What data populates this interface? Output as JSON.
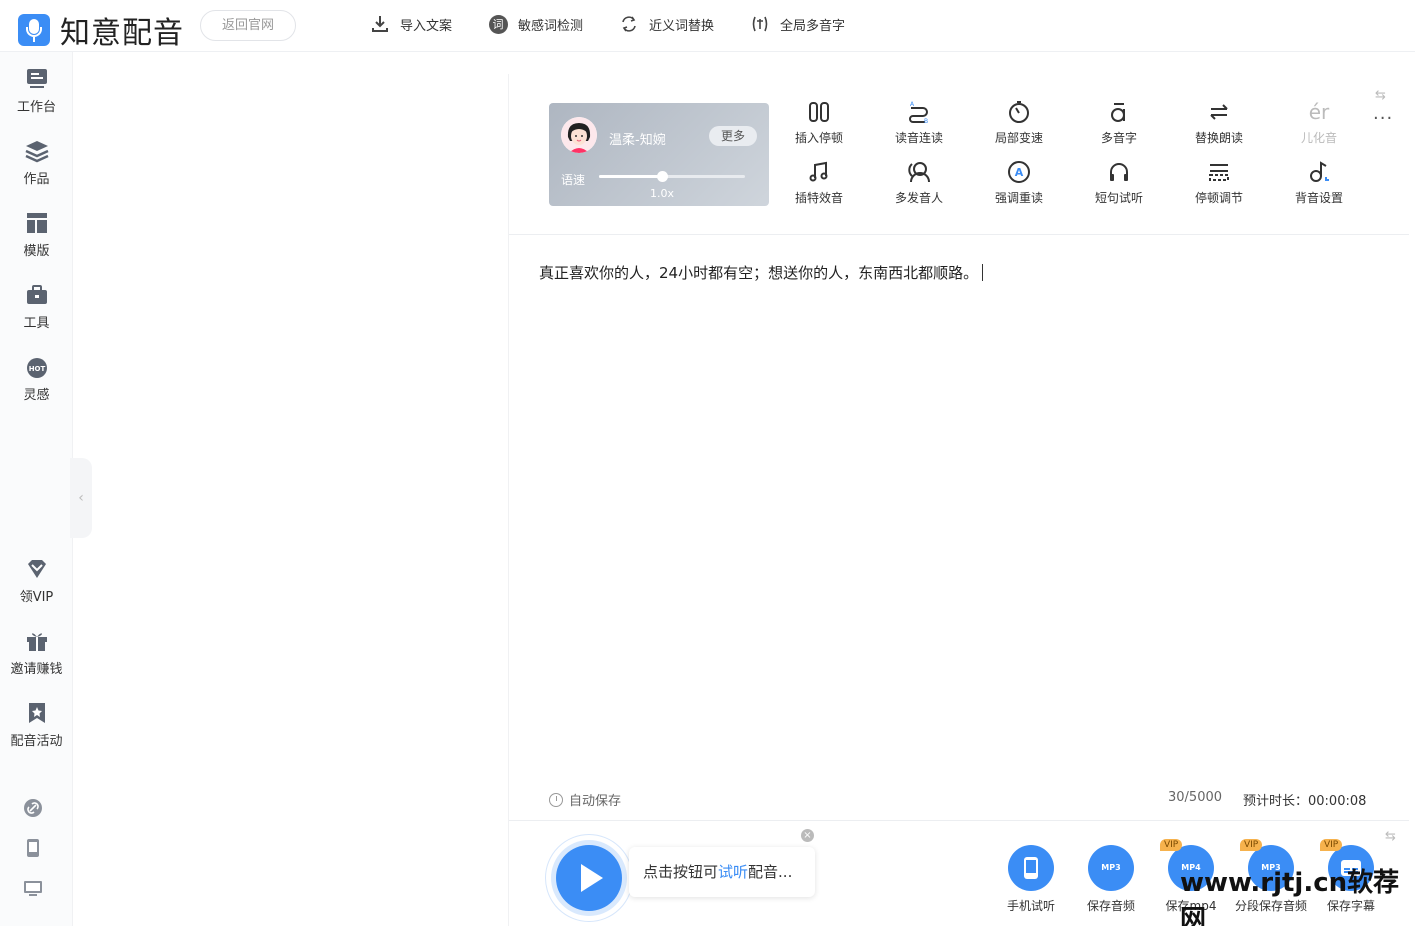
{
  "header": {
    "app_name": "知意配音",
    "back_label": "返回官网",
    "tools": [
      {
        "label": "导入文案",
        "icon": "import-icon"
      },
      {
        "label": "敏感词检测",
        "icon": "sensitive-word-icon",
        "badge": "词"
      },
      {
        "label": "近义词替换",
        "icon": "synonym-replace-icon"
      },
      {
        "label": "全局多音字",
        "icon": "polyphonic-global-icon"
      }
    ]
  },
  "sidebar": {
    "items": [
      {
        "label": "工作台",
        "icon": "workbench-icon"
      },
      {
        "label": "作品",
        "icon": "works-icon"
      },
      {
        "label": "模版",
        "icon": "template-icon"
      },
      {
        "label": "工具",
        "icon": "toolbox-icon"
      },
      {
        "label": "灵感",
        "icon": "inspiration-hot-icon",
        "badge": "HOT"
      }
    ],
    "bottom_items": [
      {
        "label": "领VIP",
        "icon": "vip-diamond-icon"
      },
      {
        "label": "邀请赚钱",
        "icon": "gift-icon"
      },
      {
        "label": "配音活动",
        "icon": "activity-star-icon"
      }
    ],
    "extra_icons": [
      "link-icon",
      "tablet-icon",
      "monitor-icon"
    ]
  },
  "voice": {
    "name": "温柔-知婉",
    "more_label": "更多",
    "speed_label": "语速",
    "speed_value": "1.0x",
    "speed_fraction": 0.43
  },
  "toolbar": {
    "row1": [
      {
        "label": "插入停顿",
        "icon": "insert-pause-icon"
      },
      {
        "label": "读音连读",
        "icon": "liaison-icon"
      },
      {
        "label": "局部变速",
        "icon": "local-speed-icon"
      },
      {
        "label": "多音字",
        "icon": "polyphonic-icon"
      },
      {
        "label": "替换朗读",
        "icon": "replace-read-icon"
      },
      {
        "label": "儿化音",
        "icon": "erhua-icon",
        "glyph": "ér",
        "disabled": true
      }
    ],
    "row2": [
      {
        "label": "插特效音",
        "icon": "sound-effect-icon"
      },
      {
        "label": "多发音人",
        "icon": "multi-speaker-icon"
      },
      {
        "label": "强调重读",
        "icon": "emphasis-icon"
      },
      {
        "label": "短句试听",
        "icon": "headphone-icon"
      },
      {
        "label": "停顿调节",
        "icon": "pause-adjust-icon"
      },
      {
        "label": "背音设置",
        "icon": "bgm-icon"
      }
    ],
    "more": "···"
  },
  "editor": {
    "text": "真正喜欢你的人，24小时都有空；想送你的人，东南西北都顺路。"
  },
  "status": {
    "autosave": "自动保存",
    "wordcount": "30/5000",
    "duration": "预计时长：00:00:08"
  },
  "bottom": {
    "tip_prefix": "点击按钮可",
    "tip_link": "试听",
    "tip_suffix": "配音...",
    "outputs": [
      {
        "label": "手机试听",
        "icon": "phone-preview-icon",
        "vip": false,
        "tag": ""
      },
      {
        "label": "保存音频",
        "icon": "save-mp3-icon",
        "vip": false,
        "tag": "MP3"
      },
      {
        "label": "保存mp4",
        "icon": "save-mp4-icon",
        "vip": true,
        "tag": "MP4"
      },
      {
        "label": "分段保存音频",
        "icon": "segment-save-icon",
        "vip": true,
        "tag": "MP3"
      },
      {
        "label": "保存字幕",
        "icon": "save-subtitle-icon",
        "vip": true,
        "tag": ""
      }
    ],
    "vip_label": "VIP"
  },
  "watermark": "www.rjtj.cn软荐网",
  "colors": {
    "accent": "#3b8df5",
    "vip": "#f6b24d"
  }
}
